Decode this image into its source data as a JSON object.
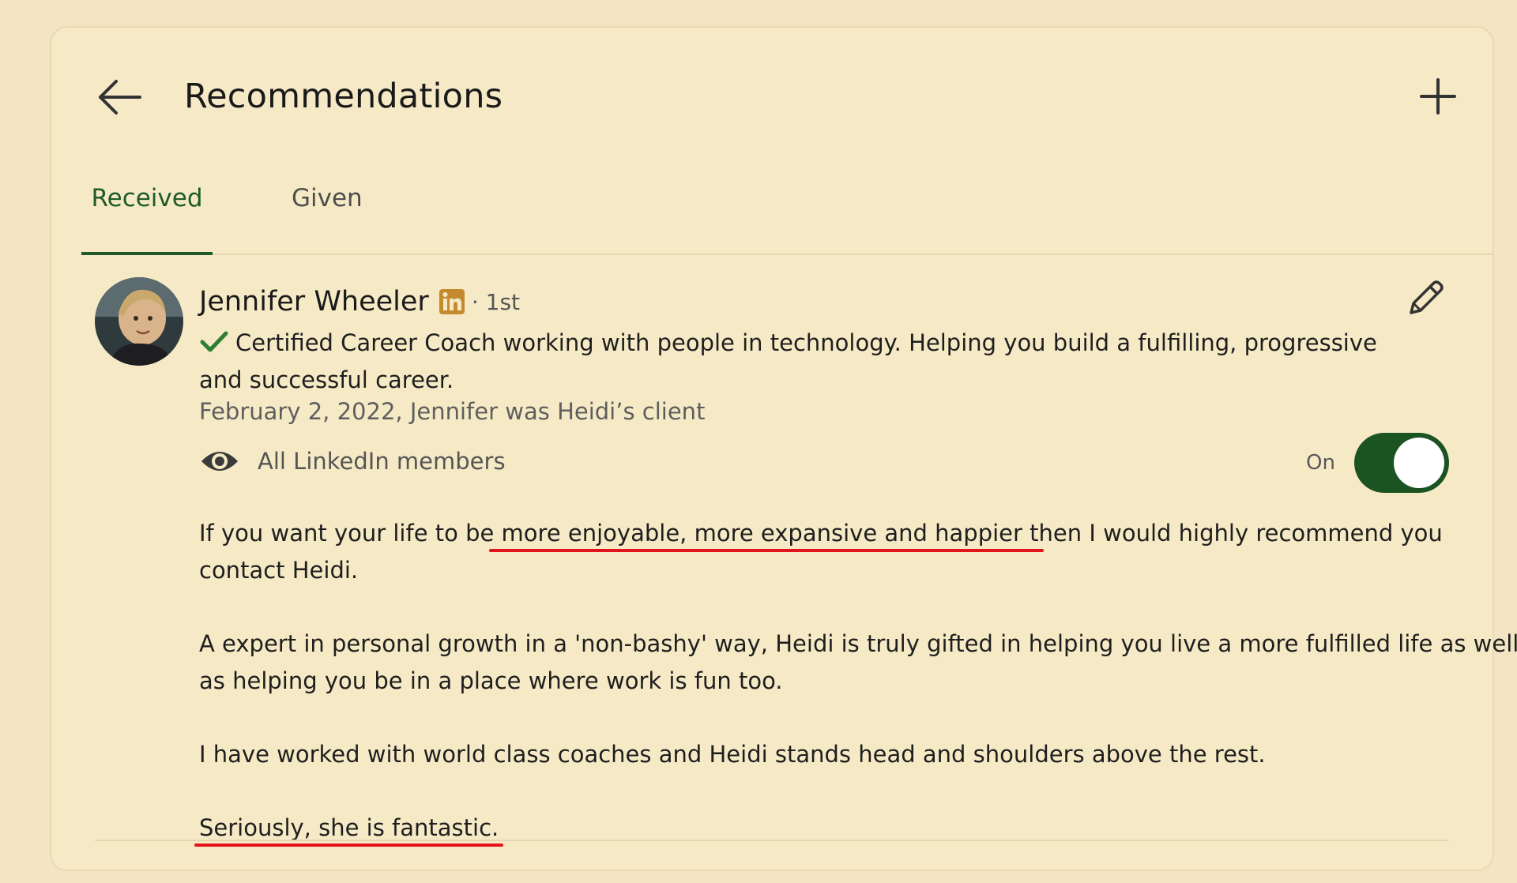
{
  "header": {
    "title": "Recommendations"
  },
  "tabs": [
    {
      "label": "Received",
      "active": true
    },
    {
      "label": "Given",
      "active": false
    }
  ],
  "recommendation": {
    "name": "Jennifer Wheeler",
    "degree": "· 1st",
    "headline": "Certified Career Coach working with people in technology. Helping you build a fulfilling, progressive and successful career.",
    "relationship": "February 2, 2022, Jennifer was Heidi’s client",
    "visibility": "All LinkedIn members",
    "toggle_label": "On",
    "toggle_state": "on",
    "paragraph1": {
      "before": "If you want your life to be",
      "highlight": " more enjoyable, more expansive and happier t",
      "after": "hen I would highly recommend you contact Heidi."
    },
    "paragraph2": "A expert in personal growth in a 'non-bashy' way, Heidi is truly gifted in helping you live a more fulfilled life as well as helping you be in a place where work is fun too.",
    "paragraph3": "I have worked with world class coaches and Heidi stands head and shoulders above the rest.",
    "paragraph4": "Seriously, she is fantastic."
  },
  "colors": {
    "page_bg": "#f3e4c4",
    "card_bg": "#f6eac6",
    "accent_green": "#1f5b2a",
    "toggle_green": "#1b5323",
    "linkedin_badge": "#c58a2e",
    "highlight_red": "#e3141b"
  },
  "icons": {
    "back": "arrow-left-icon",
    "add": "plus-icon",
    "edit": "pencil-icon",
    "verified": "checkmark-icon",
    "linkedin": "linkedin-icon",
    "visibility": "eye-icon"
  }
}
